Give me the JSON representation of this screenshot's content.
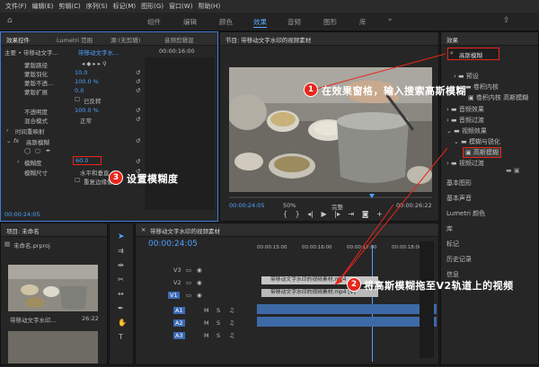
{
  "menu": [
    "文件(F)",
    "编辑(E)",
    "剪辑(C)",
    "序列(S)",
    "标记(M)",
    "图形(G)",
    "窗口(W)",
    "帮助(H)"
  ],
  "workspace_tabs": [
    "组件",
    "编辑",
    "颜色",
    "效果",
    "音频",
    "图形",
    "库"
  ],
  "effect_controls": {
    "tabs": [
      "效果控件",
      "Lumetri 范围",
      "源:(无剪辑)",
      "音频剪辑混"
    ],
    "master": "主要 • 带移动文字...",
    "seq": "带移动文字水...",
    "time": "00:00:16:00",
    "rows": [
      {
        "label": "蒙版路径",
        "value": ""
      },
      {
        "label": "蒙版羽化",
        "value": "10.0"
      },
      {
        "label": "蒙版不透...",
        "value": "100.0 %"
      },
      {
        "label": "蒙版扩展",
        "value": "0.0"
      },
      {
        "label": "已反转",
        "value": ""
      },
      {
        "label": "不透明度",
        "value": "100.0 %"
      },
      {
        "label": "混合模式",
        "value": "正常"
      },
      {
        "label": "时间重映射",
        "value": ""
      },
      {
        "label": "高斯模糊",
        "value": ""
      },
      {
        "label": "模糊度",
        "value": "60.0"
      },
      {
        "label": "模糊尺寸",
        "value": "水平和垂直"
      },
      {
        "label": "重复边缘像素",
        "value": ""
      }
    ],
    "timecode": "00:00:24:05"
  },
  "program": {
    "title": "节目: 带移动文字水印的视频素材",
    "time_left": "00:00:24:05",
    "zoom": "50%",
    "quality": "完整",
    "time_right": "00:00:26:22"
  },
  "effects_panel": {
    "title": "效果",
    "search": "高斯模糊",
    "tree": [
      "预设",
      "卷积内核",
      "卷积内核 高斯模糊",
      "音频效果",
      "音频过渡",
      "视频效果",
      "模糊与锐化",
      "高斯模糊",
      "视频过渡"
    ],
    "panels": [
      "基本图形",
      "基本声音",
      "Lumetri 颜色",
      "库",
      "标记",
      "历史记录",
      "信息"
    ]
  },
  "project": {
    "title": "项目: 未命名",
    "file": "未命名.prproj",
    "clip_name": "带移动文字水印...",
    "clip_dur": "26:22"
  },
  "timeline": {
    "title": "带移动文字水印的视频素材",
    "timecode": "00:00:24:05",
    "ruler": [
      "00:00:15:00",
      "00:00:16:00",
      "00:00:17:00",
      "00:00:18:00"
    ],
    "video_tracks": [
      "V3",
      "V2",
      "V1"
    ],
    "audio_tracks": [
      "A1",
      "A2",
      "A3"
    ],
    "v2_clip": "带移动文字水印的视频素材.mp4",
    "v1_clip": "带移动文字水印的视频素材.mp4 [V]"
  },
  "annotations": {
    "a1": {
      "num": "1",
      "text": "在效果窗格，输入搜索高斯模糊"
    },
    "a2": {
      "num": "2",
      "text": "将高斯模糊拖至V2轨道上的视频"
    },
    "a3": {
      "num": "3",
      "text": "设置模糊度"
    }
  },
  "colors": {
    "accent": "#4ea3ff",
    "annotation": "#e8261b"
  }
}
